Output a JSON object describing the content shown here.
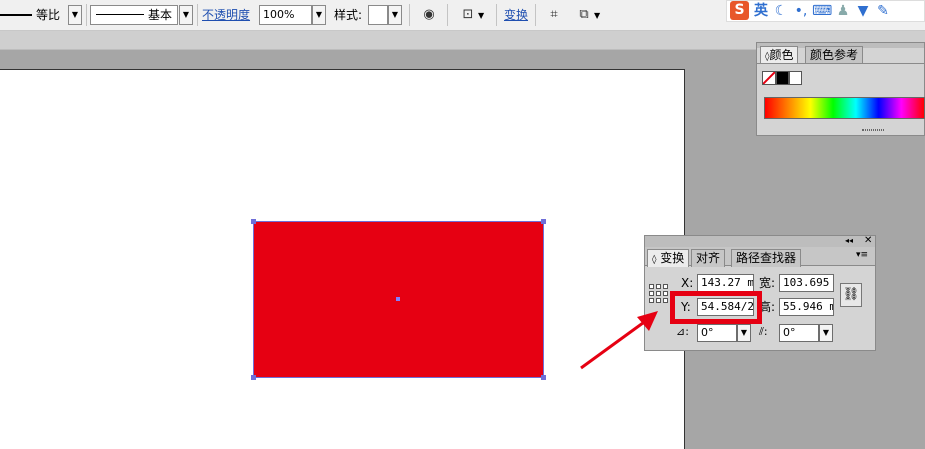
{
  "control_bar": {
    "stroke_profile_label": "等比",
    "brush_label": "基本",
    "opacity_label": "不透明度",
    "opacity_value": "100%",
    "style_label": "样式:",
    "transform_link": "变换"
  },
  "ime_toolbar": {
    "logo": "S",
    "mode": "英",
    "icons": [
      "moon-icon",
      "punctuation-icon",
      "keyboard-icon",
      "user-icon",
      "shirt-icon",
      "wrench-icon"
    ]
  },
  "color_panel": {
    "tabs": [
      {
        "label": "颜色",
        "active": true
      },
      {
        "label": "颜色参考",
        "active": false
      }
    ]
  },
  "transform_panel": {
    "tabs": [
      {
        "label": "变换",
        "active": true
      },
      {
        "label": "对齐",
        "active": false
      },
      {
        "label": "路径查找器",
        "active": false
      }
    ],
    "x_label": "X:",
    "x_value": "143.27 m",
    "y_label": "Y:",
    "y_value": "54.584/2",
    "w_label": "宽:",
    "w_value": "103.695",
    "h_label": "高:",
    "h_value": "55.946 m",
    "rotate_value": "0°",
    "shear_value": "0°"
  },
  "artwork": {
    "rectangle_fill": "#e60012",
    "selection_color": "#6f6fd8",
    "annotation_color": "#e60012"
  }
}
